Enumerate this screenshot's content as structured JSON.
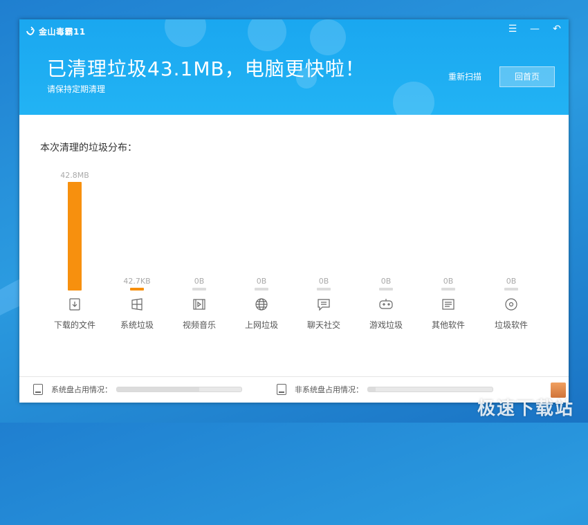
{
  "app": {
    "title": "金山毒霸11"
  },
  "window_controls": {
    "menu": "☰",
    "minimize": "—",
    "back": "↶"
  },
  "header": {
    "headline": "已清理垃圾43.1MB，电脑更快啦！",
    "subline": "请保持定期清理",
    "rescan_label": "重新扫描",
    "home_label": "回首页"
  },
  "distribution_title": "本次清理的垃圾分布：",
  "chart_data": {
    "type": "bar",
    "categories": [
      "下载的文件",
      "系统垃圾",
      "视频音乐",
      "上网垃圾",
      "聊天社交",
      "游戏垃圾",
      "其他软件",
      "垃圾软件"
    ],
    "values": [
      42.8,
      0.0427,
      0,
      0,
      0,
      0,
      0,
      0
    ],
    "unit": "MB",
    "value_labels": [
      "42.8MB",
      "42.7KB",
      "0B",
      "0B",
      "0B",
      "0B",
      "0B",
      "0B"
    ],
    "icons": [
      "download-file-icon",
      "windows-icon",
      "video-icon",
      "globe-icon",
      "chat-icon",
      "gamepad-icon",
      "software-icon",
      "disc-icon"
    ],
    "colors": {
      "filled": "#f7900e",
      "empty": "#dcdcdc"
    }
  },
  "footer": {
    "system_disk_label": "系统盘占用情况：",
    "system_disk_fraction": 0.66,
    "non_system_disk_label": "非系统盘占用情况：",
    "non_system_disk_fraction": 0.06
  },
  "watermark": "极速下载站"
}
